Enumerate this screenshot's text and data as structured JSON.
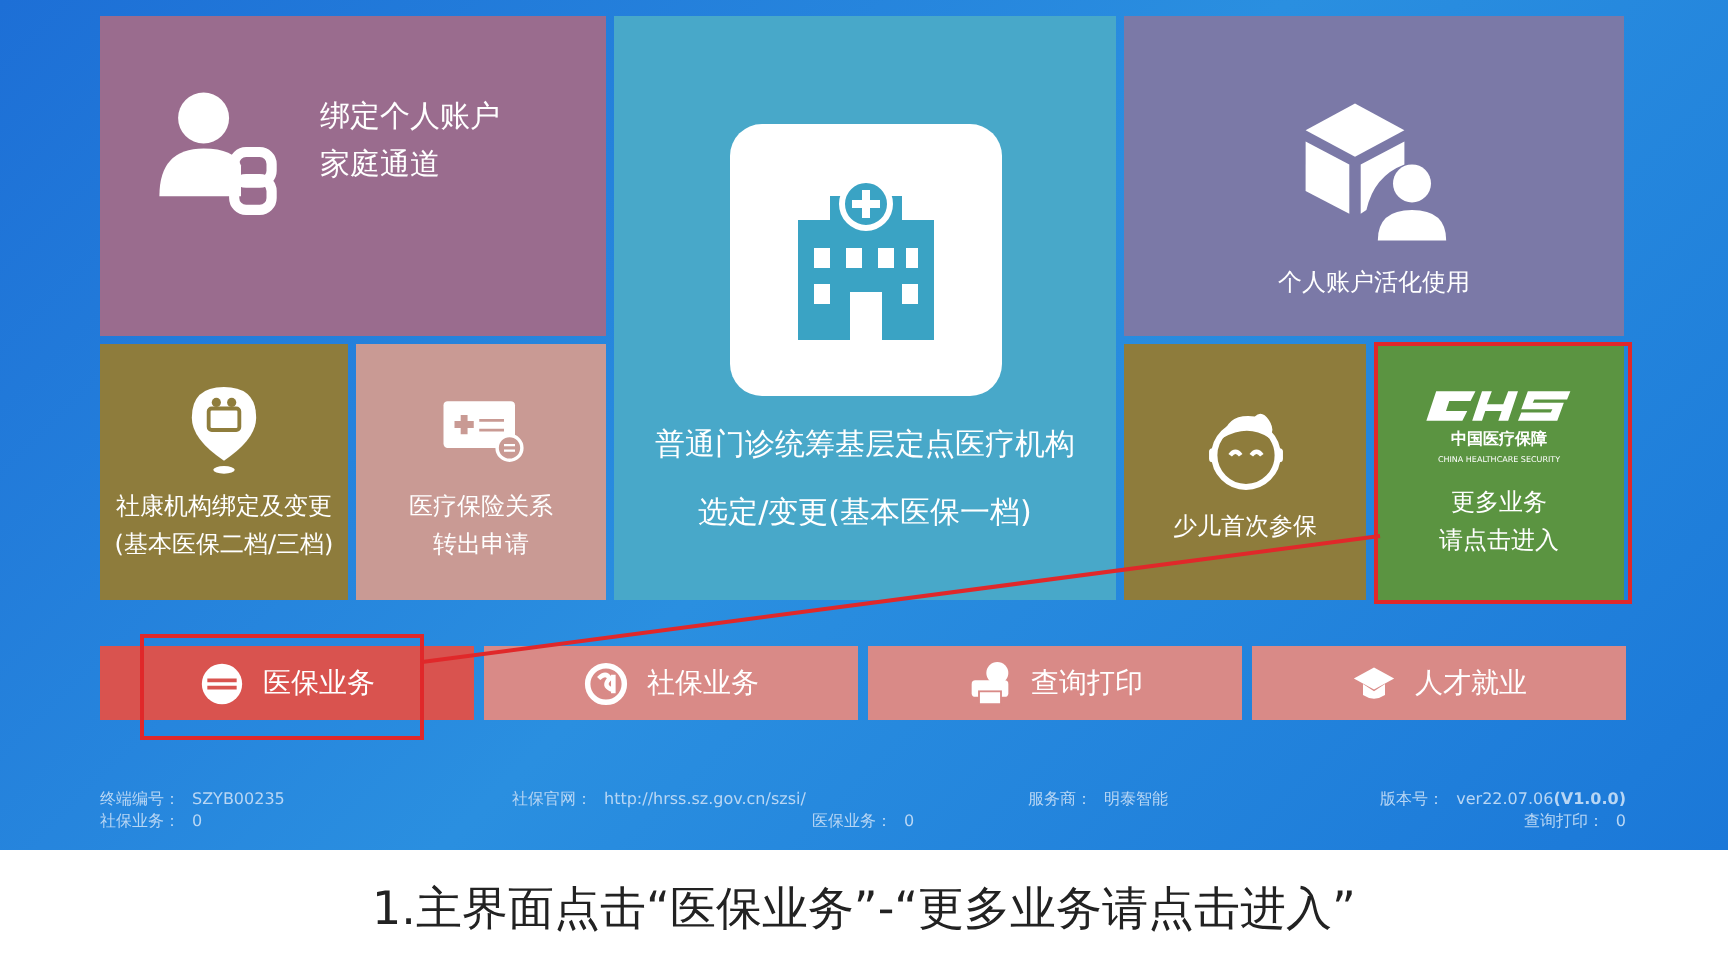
{
  "tiles": [
    {
      "kind": "family",
      "lines": [
        "绑定个人账户",
        "家庭通道"
      ]
    },
    {
      "kind": "clinic",
      "lines": [
        "普通门诊统筹基层定点医疗机构",
        "选定/变更(基本医保一档)"
      ]
    },
    {
      "kind": "activate",
      "lines": [
        "个人账户活化使用"
      ]
    },
    {
      "kind": "community",
      "lines": [
        "社康机构绑定及变更",
        "(基本医保二档/三档)"
      ]
    },
    {
      "kind": "transfer",
      "lines": [
        "医疗保险关系",
        "转出申请"
      ]
    },
    {
      "kind": "child",
      "lines": [
        "少儿首次参保"
      ]
    },
    {
      "kind": "more",
      "logo_cn": "中国医疗保障",
      "logo_en": "CHINA HEALTHCARE SECURITY",
      "lines": [
        "更多业务",
        "请点击进入"
      ]
    }
  ],
  "tabs": [
    {
      "kind": "medical",
      "label": "医保业务",
      "selected": true
    },
    {
      "kind": "social",
      "label": "社保业务",
      "selected": false
    },
    {
      "kind": "print",
      "label": "查询打印",
      "selected": false
    },
    {
      "kind": "talent",
      "label": "人才就业",
      "selected": false
    }
  ],
  "status_bar": {
    "row_1": [
      {
        "label": "终端编号：",
        "value": "SZYB00235"
      },
      {
        "label": "社保官网：",
        "value": "http://hrss.sz.gov.cn/szsi/"
      },
      {
        "label": "服务商：",
        "value": "明泰智能"
      },
      {
        "label": "版本号：",
        "value": "ver22.07.06**(V1.0.0)**"
      }
    ],
    "row_2": [
      {
        "label": "社保业务：",
        "value": "0"
      },
      {
        "label": "医保业务：",
        "value": "0"
      },
      {
        "label": "查询打印：",
        "value": "0"
      }
    ]
  },
  "caption": "1.主界面点击“医保业务”-“更多业务请点击进入”"
}
